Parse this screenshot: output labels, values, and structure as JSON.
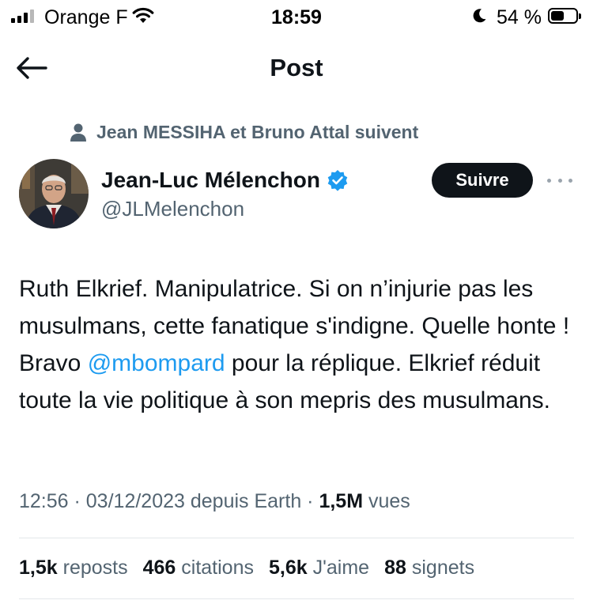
{
  "status_bar": {
    "carrier": "Orange F",
    "time": "18:59",
    "battery": "54 %",
    "battery_level": 0.54,
    "icons": [
      "signal-icon",
      "wifi-icon",
      "moon-icon",
      "battery-icon"
    ]
  },
  "header": {
    "title": "Post",
    "back_icon": "arrow-left-icon"
  },
  "social_context": {
    "icon": "person-icon",
    "text": "Jean MESSIHA et Bruno Attal suivent"
  },
  "author": {
    "name": "Jean-Luc Mélenchon",
    "handle": "@JLMelenchon",
    "verified_icon": "verified-badge-icon",
    "follow_label": "Suivre",
    "more_icon": "more-dots-icon"
  },
  "tweet": {
    "text_before": "Ruth Elkrief. Manipulatrice. Si on n’injurie pas les musulmans, cette fanatique s'indigne. Quelle honte ! Bravo ",
    "mention": "@mbompard",
    "text_after": " pour la réplique. Elkrief réduit toute la vie politique à son mepris des musulmans."
  },
  "meta": {
    "time": "12:56",
    "date": "03/12/2023",
    "source": "depuis Earth",
    "views_count": "1,5M",
    "views_label": "vues"
  },
  "stats": [
    {
      "count": "1,5k",
      "label": "reposts"
    },
    {
      "count": "466",
      "label": "citations"
    },
    {
      "count": "5,6k",
      "label": "J'aime"
    },
    {
      "count": "88",
      "label": "signets"
    }
  ],
  "colors": {
    "link": "#1d9bf0",
    "verified": "#1d9bf0",
    "secondary_text": "#536471",
    "follow_button_bg": "#0f1419"
  }
}
